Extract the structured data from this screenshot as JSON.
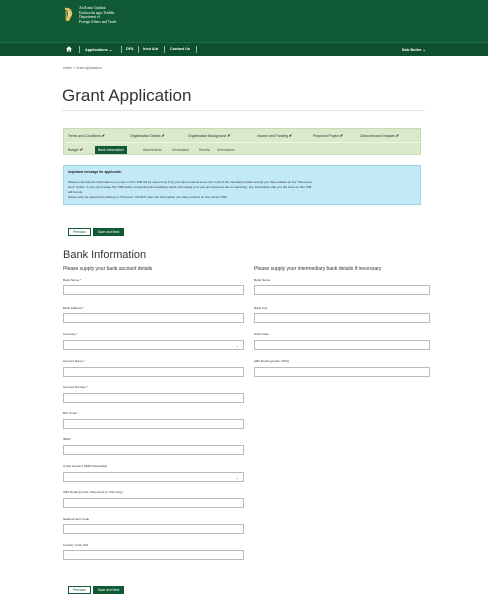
{
  "header": {
    "dept_lines": [
      "An Roinn Gnóthaí",
      "Eachtracha agus Trádála",
      "Department of",
      "Foreign Affairs and Trade"
    ],
    "harp_icon": "harp-icon"
  },
  "nav": {
    "home_icon": "home-icon",
    "items": [
      "Applications ⌄",
      "DFA",
      "Irish Aid",
      "Contact Us"
    ],
    "user": "Bob Butler ⌄"
  },
  "breadcrumb": "Home  >  Grant Application",
  "page_title": "Grant Application",
  "steps": {
    "completed": [
      "Terms and Conditions",
      "Organisation Details",
      "Organisation Background",
      "Income and Funding",
      "Proposed Project",
      "Outcomes and Impacts",
      "Budget"
    ],
    "active": "Bank Information",
    "todo": [
      "Attachments",
      "Declaration",
      "Review",
      "Submission"
    ],
    "check_glyph": "✔"
  },
  "alert": {
    "title": "Important message for applicants:",
    "lines": [
      "Please note that the information you enter on this TAB will be saved only if (1) you have entered some text in all of the mandatory fields and (2) you have clicked on the \"Save and",
      "Next\" button. If you opt to leave this TAB before completing all mandatory fields and saving (or if you are timed out due to inactivity), any information that you did enter on this TAB",
      "will be lost.",
      "Please also be aware that clicking on \"Previous\" will NOT save the information you have entered on the current TAB."
    ]
  },
  "buttons": {
    "previous": "Previous",
    "save_next": "Save and Next"
  },
  "section_title": "Bank Information",
  "left_heading": "Please supply your bank account details",
  "right_heading": "Please supply your intermediary bank details if necessary",
  "left_fields": [
    {
      "label": "Bank Name",
      "required": true,
      "type": "text"
    },
    {
      "label": "Bank Address",
      "required": true,
      "type": "text"
    },
    {
      "label": "Currency",
      "required": true,
      "type": "select"
    },
    {
      "label": "Account Name",
      "required": true,
      "type": "text"
    },
    {
      "label": "Account Number",
      "required": true,
      "type": "text"
    },
    {
      "label": "BIC Code",
      "required": true,
      "type": "text"
    },
    {
      "label": "IBAN",
      "required": true,
      "type": "text"
    },
    {
      "label": "Is this account SEPA Reachable",
      "required": false,
      "type": "select"
    },
    {
      "label": "ABA Routing Code (Payments to USA only)",
      "required": false,
      "type": "text"
    },
    {
      "label": "National Sort Code",
      "required": false,
      "type": "text"
    },
    {
      "label": "Country Code ISO",
      "required": false,
      "type": "text"
    }
  ],
  "right_fields": [
    {
      "label": "Bank Name",
      "required": false,
      "type": "text"
    },
    {
      "label": "Bank City",
      "required": false,
      "type": "text"
    },
    {
      "label": "Swift Code",
      "required": false,
      "type": "text"
    },
    {
      "label": "ABA Routing Code (USA)",
      "required": false,
      "type": "text"
    }
  ],
  "required_marker": "*",
  "select_chevron": "⌄",
  "colors": {
    "header": "#105a36",
    "steps_bg": "#d9e9c9",
    "alert_bg": "#c2e9f5",
    "required": "#c0392b"
  }
}
